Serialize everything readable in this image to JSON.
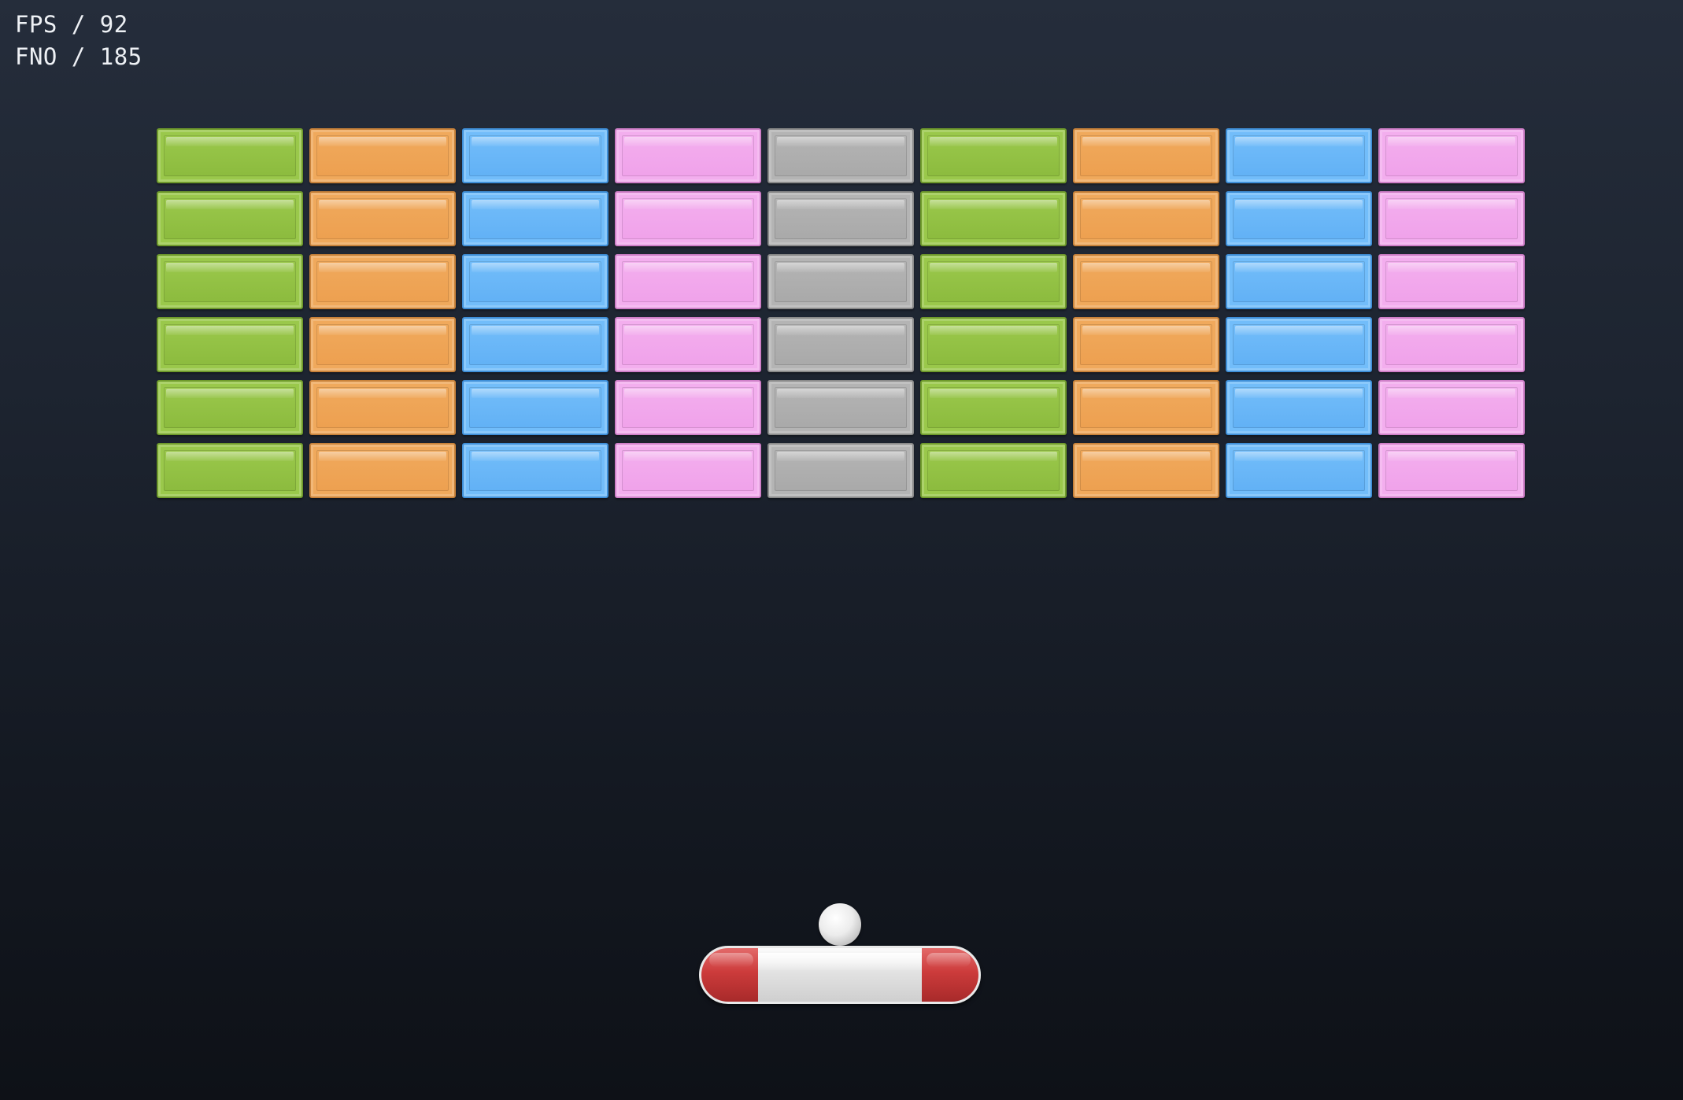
{
  "hud": {
    "fps_line": "FPS / 92",
    "fno_line": "FNO / 185"
  },
  "colors": {
    "green": {
      "base": "#9ac84b",
      "inner": "#8cbb3e",
      "edge": "#6f9a2c"
    },
    "orange": {
      "base": "#f0a95c",
      "inner": "#eda050",
      "edge": "#c8823a"
    },
    "blue": {
      "base": "#72bdfa",
      "inner": "#62b1f5",
      "edge": "#3f8fd8"
    },
    "pink": {
      "base": "#f3aeee",
      "inner": "#f0a2ea",
      "edge": "#cf7fc8"
    },
    "gray": {
      "base": "#b4b4b4",
      "inner": "#a9a9a9",
      "edge": "#8a8a8a"
    }
  },
  "bricks": {
    "columns": [
      "green",
      "orange",
      "blue",
      "pink",
      "gray",
      "green",
      "orange",
      "blue",
      "pink"
    ],
    "row_count": 6
  },
  "ball": {
    "color": "#e6e6e6"
  },
  "paddle": {
    "cap_color": "#cc3b3b",
    "body_color": "#e4e4e4"
  }
}
